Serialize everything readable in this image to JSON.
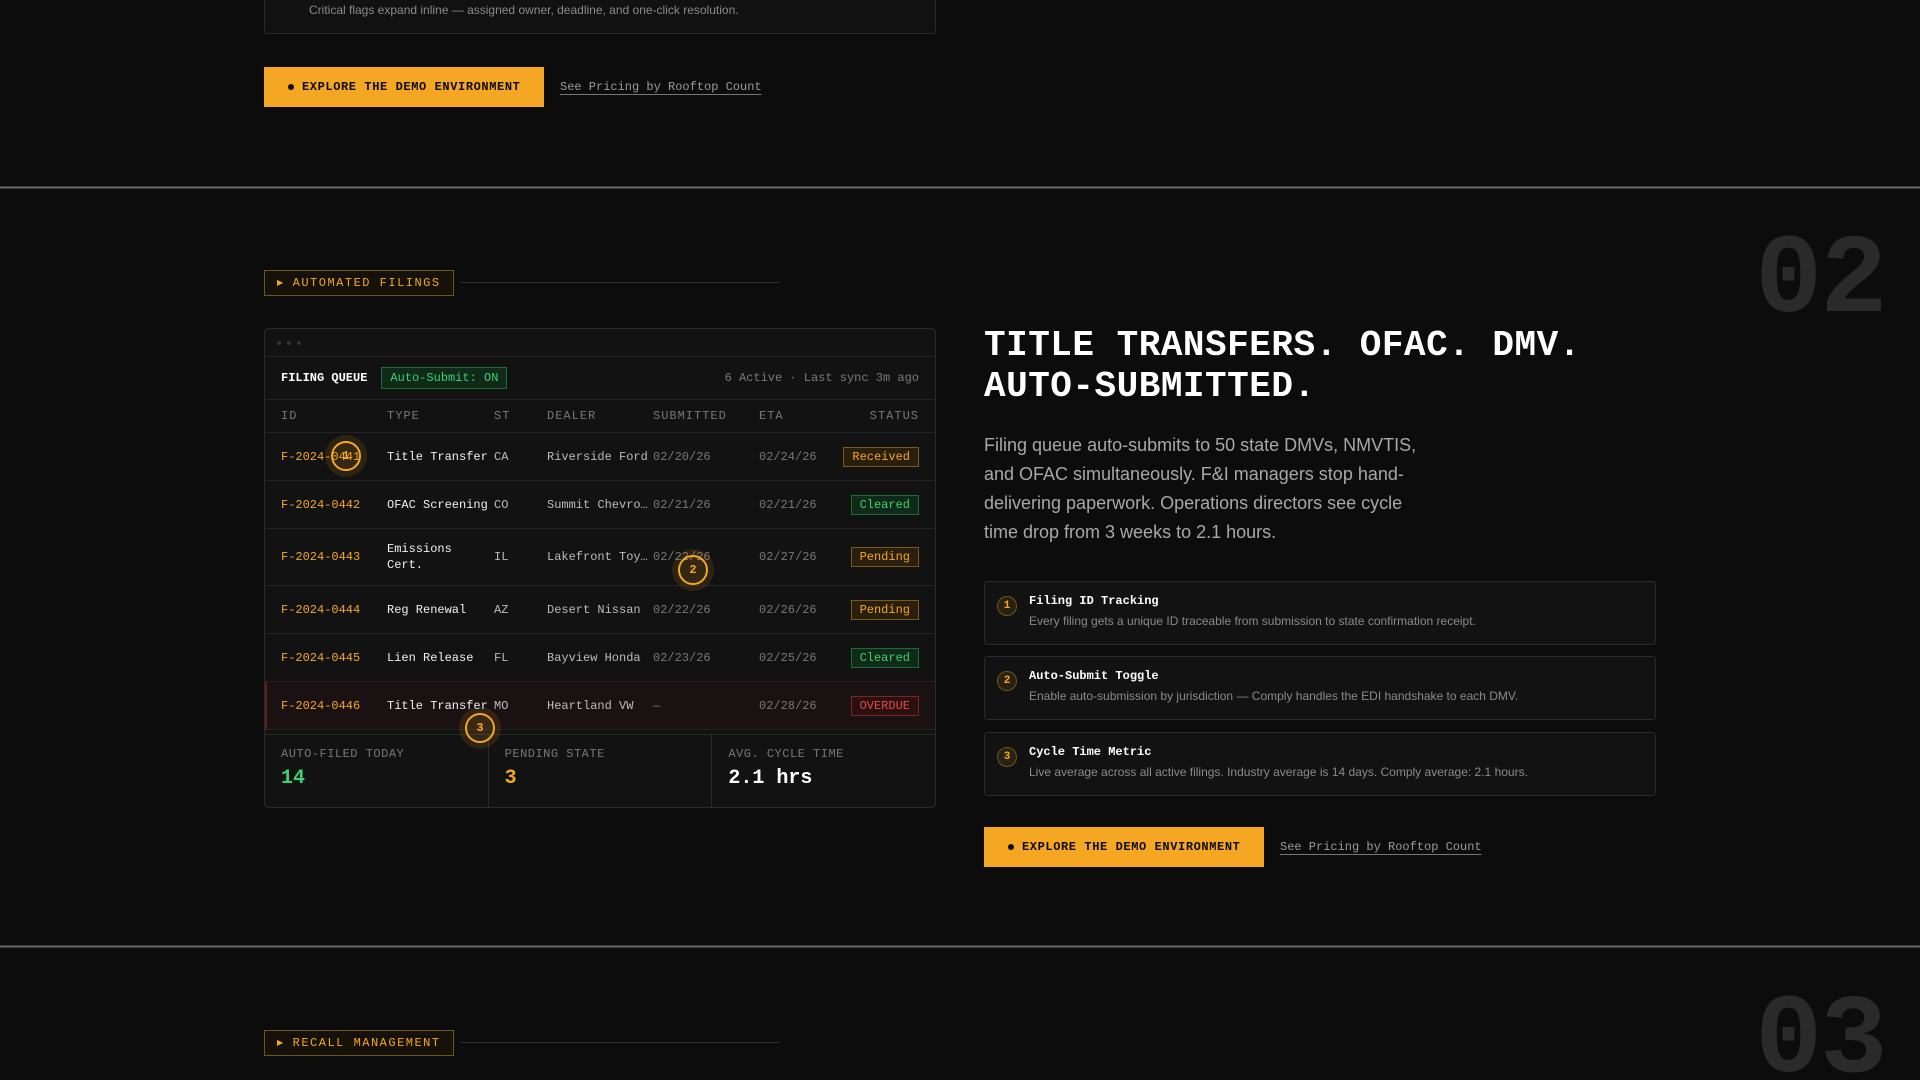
{
  "top": {
    "note": "Critical flags expand inline — assigned owner, deadline, and one-click resolution.",
    "cta_label": "EXPLORE THE DEMO ENVIRONMENT",
    "link_label": "See Pricing by Rooftop Count"
  },
  "section2": {
    "number": "02",
    "tag": "AUTOMATED FILINGS",
    "tag_icon": "triangle-right-icon",
    "queue": {
      "title": "FILING QUEUE",
      "auto_badge": "Auto-Submit: ON",
      "meta": "6 Active · Last sync 3m ago",
      "columns": [
        "ID",
        "TYPE",
        "ST",
        "DEALER",
        "SUBMITTED",
        "ETA",
        "STATUS"
      ],
      "rows": [
        {
          "id": "F-2024-0441",
          "type": "Title Transfer",
          "st": "CA",
          "dealer": "Riverside Ford",
          "submitted": "02/20/26",
          "eta": "02/24/26",
          "status": "Received",
          "kind": "received"
        },
        {
          "id": "F-2024-0442",
          "type": "OFAC Screening",
          "st": "CO",
          "dealer": "Summit Chevrolet",
          "submitted": "02/21/26",
          "eta": "02/21/26",
          "status": "Cleared",
          "kind": "cleared"
        },
        {
          "id": "F-2024-0443",
          "type": "Emissions Cert.",
          "st": "IL",
          "dealer": "Lakefront Toyota",
          "submitted": "02/22/26",
          "eta": "02/27/26",
          "status": "Pending",
          "kind": "pending"
        },
        {
          "id": "F-2024-0444",
          "type": "Reg Renewal",
          "st": "AZ",
          "dealer": "Desert Nissan",
          "submitted": "02/22/26",
          "eta": "02/26/26",
          "status": "Pending",
          "kind": "pending"
        },
        {
          "id": "F-2024-0445",
          "type": "Lien Release",
          "st": "FL",
          "dealer": "Bayview Honda",
          "submitted": "02/23/26",
          "eta": "02/25/26",
          "status": "Cleared",
          "kind": "cleared"
        },
        {
          "id": "F-2024-0446",
          "type": "Title Transfer",
          "st": "MO",
          "dealer": "Heartland VW",
          "submitted": "—",
          "eta": "02/28/26",
          "status": "OVERDUE",
          "kind": "overdue"
        }
      ],
      "stats": [
        {
          "label": "AUTO-FILED TODAY",
          "value": "14",
          "color": "#3ecf6e"
        },
        {
          "label": "PENDING STATE",
          "value": "3",
          "color": "#f5a623"
        },
        {
          "label": "AVG. CYCLE TIME",
          "value": "2.1 hrs",
          "color": "#ffffff"
        }
      ],
      "markers": [
        "1",
        "2",
        "3"
      ]
    },
    "headline_line1": "TITLE TRANSFERS. OFAC. DMV.",
    "headline_line2": "AUTO-SUBMITTED.",
    "paragraph": "Filing queue auto-submits to 50 state DMVs, NMVTIS, and OFAC simultaneously. F&I managers stop hand-delivering paperwork. Operations directors see cycle time drop from 3 weeks to 2.1 hours.",
    "features": [
      {
        "num": "1",
        "title": "Filing ID Tracking",
        "desc": "Every filing gets a unique ID traceable from submission to state confirmation receipt."
      },
      {
        "num": "2",
        "title": "Auto-Submit Toggle",
        "desc": "Enable auto-submission by jurisdiction — Comply handles the EDI handshake to each DMV."
      },
      {
        "num": "3",
        "title": "Cycle Time Metric",
        "desc": "Live average across all active filings. Industry average is 14 days. Comply average: 2.1 hours."
      }
    ],
    "cta_label": "EXPLORE THE DEMO ENVIRONMENT",
    "link_label": "See Pricing by Rooftop Count"
  },
  "section3": {
    "number": "03",
    "tag": "RECALL MANAGEMENT"
  },
  "colors": {
    "accent": "#f5a623",
    "success": "#3ecf6e",
    "danger": "#e5484d",
    "background": "#0c0c0c"
  }
}
